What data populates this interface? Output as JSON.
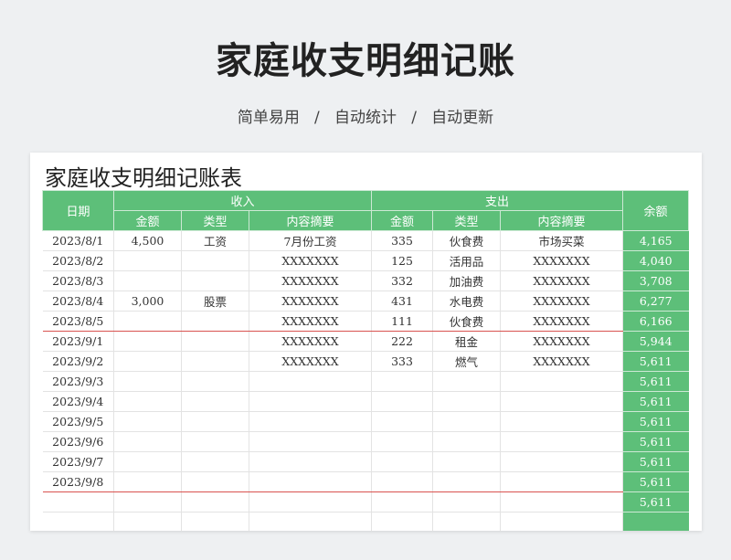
{
  "header": {
    "title": "家庭收支明细记账",
    "subtitle": "简单易用   /   自动统计   /   自动更新"
  },
  "sheet": {
    "title": "家庭收支明细记账表",
    "columns": {
      "date": "日期",
      "income": "收入",
      "expense": "支出",
      "balance": "余额",
      "amount": "金额",
      "type": "类型",
      "summary": "内容摘要"
    },
    "rows": [
      {
        "date": "2023/8/1",
        "in_amount": "4,500",
        "in_type": "工资",
        "in_summary": "7月份工资",
        "out_amount": "335",
        "out_type": "伙食费",
        "out_summary": "市场买菜",
        "balance": "4,165"
      },
      {
        "date": "2023/8/2",
        "in_amount": "",
        "in_type": "",
        "in_summary": "XXXXXXX",
        "out_amount": "125",
        "out_type": "活用品",
        "out_summary": "XXXXXXX",
        "balance": "4,040"
      },
      {
        "date": "2023/8/3",
        "in_amount": "",
        "in_type": "",
        "in_summary": "XXXXXXX",
        "out_amount": "332",
        "out_type": "加油费",
        "out_summary": "XXXXXXX",
        "balance": "3,708"
      },
      {
        "date": "2023/8/4",
        "in_amount": "3,000",
        "in_type": "股票",
        "in_summary": "XXXXXXX",
        "out_amount": "431",
        "out_type": "水电费",
        "out_summary": "XXXXXXX",
        "balance": "6,277"
      },
      {
        "date": "2023/8/5",
        "in_amount": "",
        "in_type": "",
        "in_summary": "XXXXXXX",
        "out_amount": "111",
        "out_type": "伙食费",
        "out_summary": "XXXXXXX",
        "balance": "6,166"
      },
      {
        "date": "2023/9/1",
        "in_amount": "",
        "in_type": "",
        "in_summary": "XXXXXXX",
        "out_amount": "222",
        "out_type": "租金",
        "out_summary": "XXXXXXX",
        "balance": "5,944"
      },
      {
        "date": "2023/9/2",
        "in_amount": "",
        "in_type": "",
        "in_summary": "XXXXXXX",
        "out_amount": "333",
        "out_type": "燃气",
        "out_summary": "XXXXXXX",
        "balance": "5,611"
      },
      {
        "date": "2023/9/3",
        "in_amount": "",
        "in_type": "",
        "in_summary": "",
        "out_amount": "",
        "out_type": "",
        "out_summary": "",
        "balance": "5,611"
      },
      {
        "date": "2023/9/4",
        "in_amount": "",
        "in_type": "",
        "in_summary": "",
        "out_amount": "",
        "out_type": "",
        "out_summary": "",
        "balance": "5,611"
      },
      {
        "date": "2023/9/5",
        "in_amount": "",
        "in_type": "",
        "in_summary": "",
        "out_amount": "",
        "out_type": "",
        "out_summary": "",
        "balance": "5,611"
      },
      {
        "date": "2023/9/6",
        "in_amount": "",
        "in_type": "",
        "in_summary": "",
        "out_amount": "",
        "out_type": "",
        "out_summary": "",
        "balance": "5,611"
      },
      {
        "date": "2023/9/7",
        "in_amount": "",
        "in_type": "",
        "in_summary": "",
        "out_amount": "",
        "out_type": "",
        "out_summary": "",
        "balance": "5,611"
      },
      {
        "date": "2023/9/8",
        "in_amount": "",
        "in_type": "",
        "in_summary": "",
        "out_amount": "",
        "out_type": "",
        "out_summary": "",
        "balance": "5,611"
      },
      {
        "date": "",
        "in_amount": "",
        "in_type": "",
        "in_summary": "",
        "out_amount": "",
        "out_type": "",
        "out_summary": "",
        "balance": "5,611"
      },
      {
        "date": "",
        "in_amount": "",
        "in_type": "",
        "in_summary": "",
        "out_amount": "",
        "out_type": "",
        "out_summary": "",
        "balance": ""
      }
    ]
  }
}
